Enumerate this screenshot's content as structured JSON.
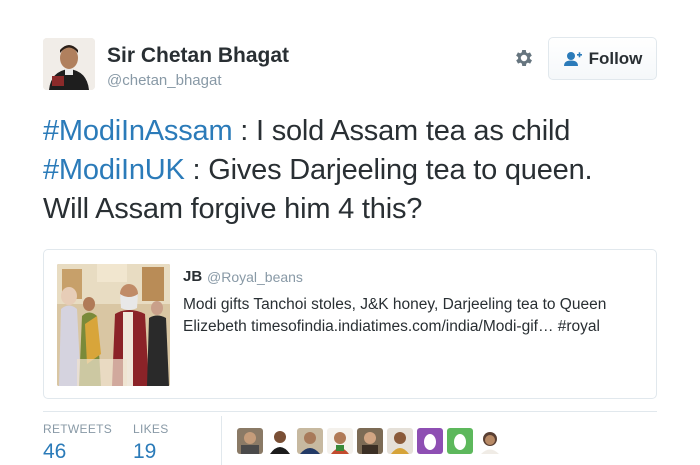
{
  "author": {
    "name": "Sir Chetan Bhagat",
    "handle": "@chetan_bhagat"
  },
  "actions": {
    "follow_label": "Follow"
  },
  "tweet": {
    "lines": [
      {
        "hashtag": "#ModiInAssam",
        "text": " : I sold Assam tea as child"
      },
      {
        "hashtag": "#ModiInUK",
        "text": " : Gives Darjeeling tea to queen."
      },
      {
        "hashtag": "",
        "text": "Will Assam forgive him 4 this?"
      }
    ]
  },
  "quoted": {
    "name": "JB",
    "handle": "@Royal_beans",
    "text_line1": "Modi gifts Tanchoi stoles, J&K honey, Darjeeling tea to Queen",
    "text_line2": "Elizebeth timesofindia.indiatimes.com/india/Modi-gif… #royal"
  },
  "stats": {
    "retweets_label": "RETWEETS",
    "retweets_value": "46",
    "likes_label": "LIKES",
    "likes_value": "19"
  },
  "colors": {
    "link": "#2b7bb9",
    "muted": "#8899a6",
    "text": "#292f33",
    "border": "#e1e8ed"
  },
  "icons": {
    "gear": "gear-icon",
    "follow": "add-user-icon"
  }
}
